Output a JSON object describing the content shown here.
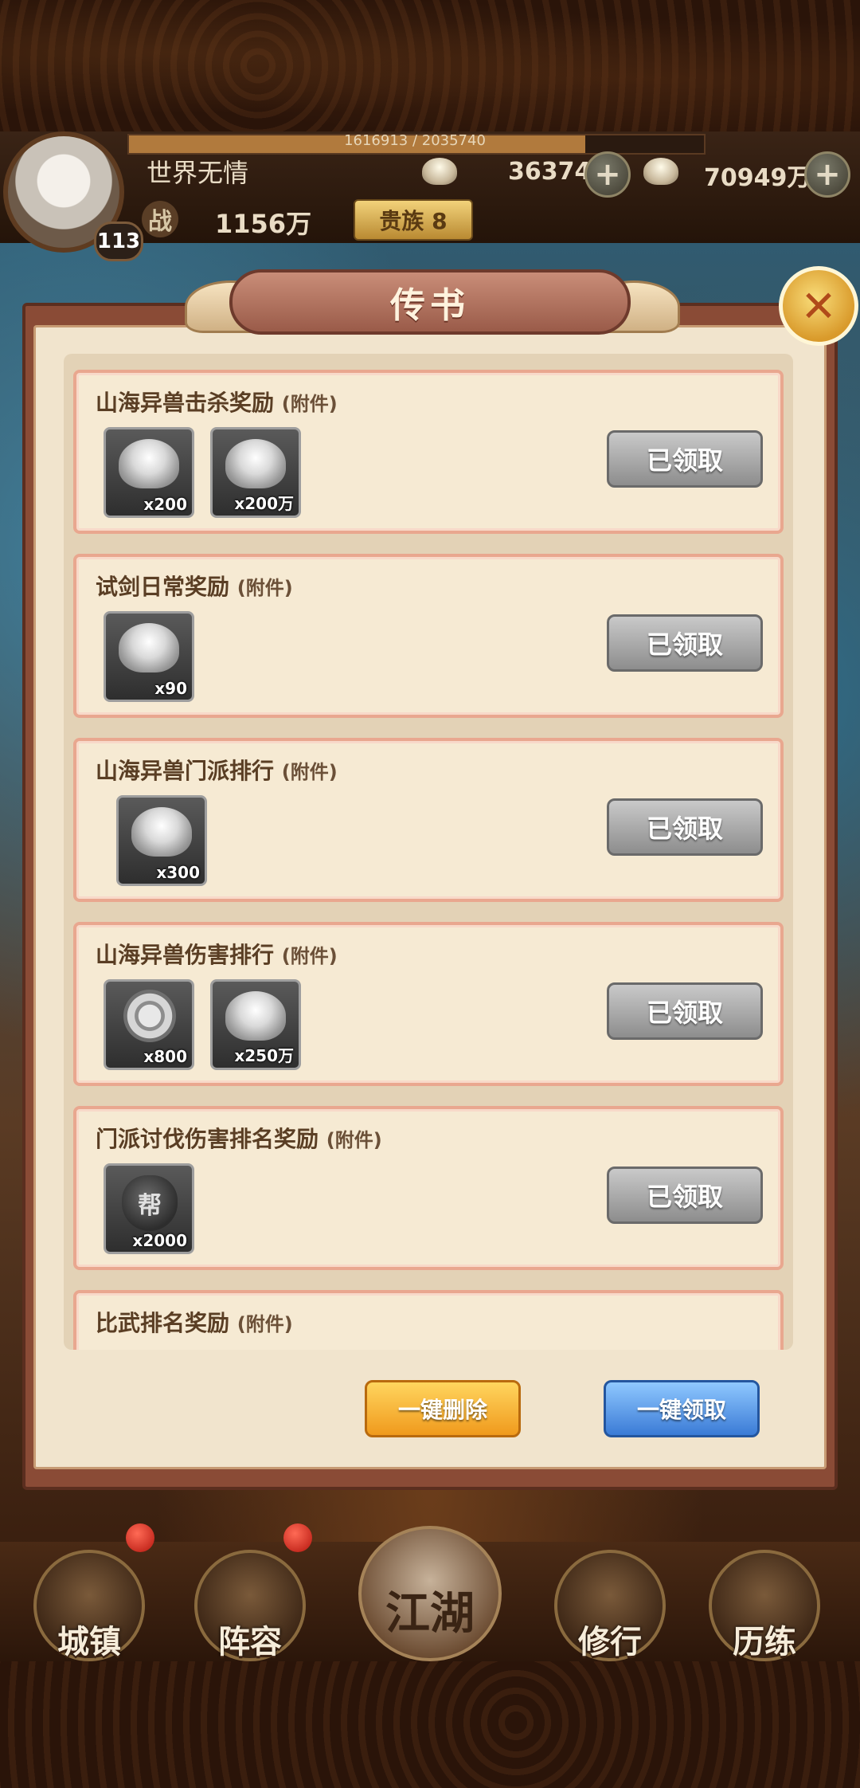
{
  "player": {
    "name": "世界无情",
    "level": "113",
    "exp_text": "1616913 / 2035740",
    "exp_progress": 0.794,
    "power_label": "战",
    "power_value": "1156万",
    "vip_label": "贵族 8"
  },
  "currencies": [
    {
      "icon": "silver-ingot-icon",
      "value": "36374"
    },
    {
      "icon": "silver-ingot-icon",
      "value": "70949万"
    }
  ],
  "modal": {
    "title": "传书",
    "close_icon": "close-icon"
  },
  "mails": [
    {
      "title": "山海异兽击杀奖励",
      "suffix": "(附件)",
      "items": [
        {
          "icon": "silver-ingot-icon",
          "count": "x200"
        },
        {
          "icon": "silver-ingot-icon",
          "count": "x200万"
        }
      ],
      "button": "已领取"
    },
    {
      "title": "试剑日常奖励",
      "suffix": "(附件)",
      "items": [
        {
          "icon": "silver-ingot-icon",
          "count": "x90"
        }
      ],
      "button": "已领取"
    },
    {
      "title": "山海异兽门派排行",
      "suffix": "(附件)",
      "items": [
        {
          "icon": "silver-ingot-icon",
          "count": "x300"
        }
      ],
      "button": "已领取"
    },
    {
      "title": "山海异兽伤害排行",
      "suffix": "(附件)",
      "items": [
        {
          "icon": "coin-icon",
          "count": "x800"
        },
        {
          "icon": "silver-ingot-icon",
          "count": "x250万"
        }
      ],
      "button": "已领取"
    },
    {
      "title": "门派讨伐伤害排名奖励",
      "suffix": "(附件)",
      "items": [
        {
          "icon": "sect-bag-icon",
          "count": "x2000",
          "glyph": "帮"
        }
      ],
      "button": "已领取"
    },
    {
      "title": "比武排名奖励",
      "suffix": "(附件)",
      "items": [],
      "button": ""
    }
  ],
  "actions": {
    "delete_all": "一键删除",
    "claim_all": "一键领取"
  },
  "nav": [
    {
      "label": "城镇"
    },
    {
      "label": "阵容"
    },
    {
      "label": "江湖"
    },
    {
      "label": "修行"
    },
    {
      "label": "历练"
    }
  ],
  "colors": {
    "claimed_button": "#9a9a9a",
    "delete_button": "#f5b238",
    "claim_all_button": "#4d8ee0",
    "card_border": "#e9a78f"
  }
}
